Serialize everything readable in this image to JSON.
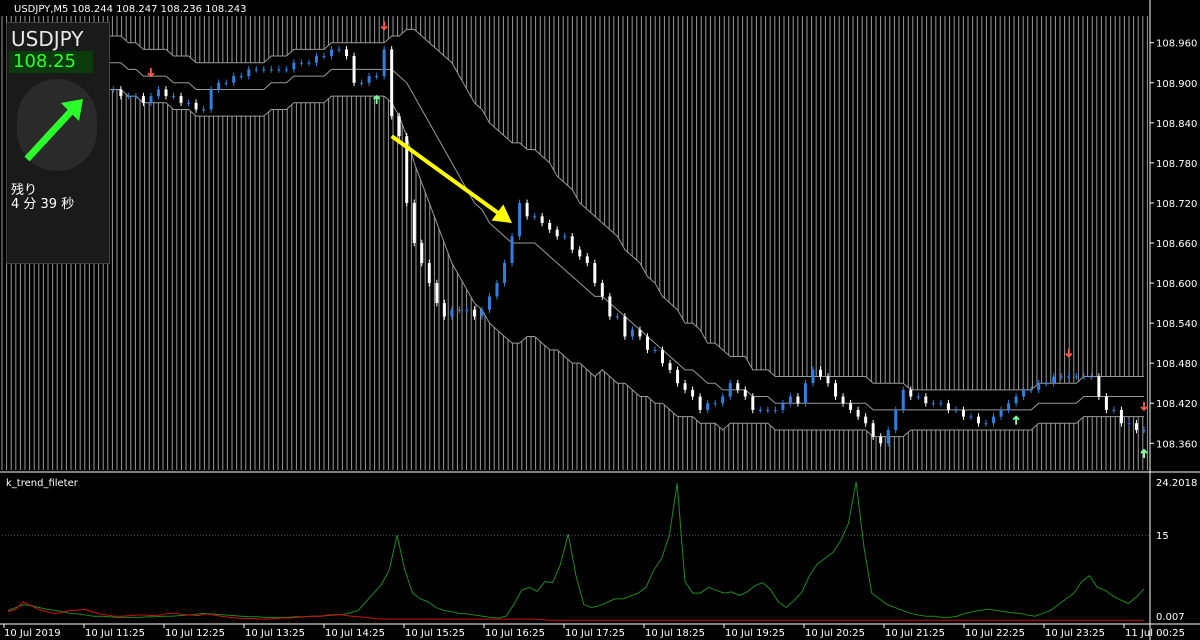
{
  "header": {
    "symbol_line": "USDJPY,M5  108.244 108.247 108.236 108.243"
  },
  "indicator_label": "k_trend_fileter",
  "panel": {
    "symbol": "USDJPY",
    "price": "108.25",
    "remaining_label": "残り",
    "remaining_value": "4 分 39 秒"
  },
  "colors": {
    "background": "#000000",
    "bull_candle": "#2f7fe0",
    "bear_candle": "#ffffff",
    "band_line": "#9a9a9a",
    "down_arrow": "#ff5a4a",
    "up_arrow": "#7dff9a",
    "big_arrow": "#ffff00",
    "green_line": "#1e8a1e",
    "red_line": "#d01010"
  },
  "chart_data": [
    {
      "type": "candlestick",
      "title": "USDJPY,M5",
      "ylim": [
        108.32,
        109.0
      ],
      "yticks": [
        "108.960",
        "108.900",
        "108.840",
        "108.780",
        "108.720",
        "108.660",
        "108.600",
        "108.540",
        "108.480",
        "108.420",
        "108.360"
      ],
      "xticks": [
        "10 Jul 2019",
        "10 Jul 11:25",
        "10 Jul 12:25",
        "10 Jul 13:25",
        "10 Jul 14:25",
        "10 Jul 15:25",
        "10 Jul 16:25",
        "10 Jul 17:25",
        "10 Jul 18:25",
        "10 Jul 19:25",
        "10 Jul 20:25",
        "10 Jul 21:25",
        "10 Jul 22:25",
        "10 Jul 23:25",
        "11 Jul 00:25"
      ],
      "close": [
        108.93,
        108.95,
        108.94,
        108.94,
        108.95,
        108.93,
        108.95,
        108.96,
        108.95,
        108.93,
        108.92,
        108.91,
        108.9,
        108.89,
        108.89,
        108.88,
        108.88,
        108.88,
        108.87,
        108.88,
        108.89,
        108.88,
        108.88,
        108.87,
        108.87,
        108.86,
        108.86,
        108.89,
        108.9,
        108.9,
        108.91,
        108.91,
        108.92,
        108.92,
        108.92,
        108.92,
        108.92,
        108.92,
        108.93,
        108.93,
        108.93,
        108.94,
        108.94,
        108.95,
        108.95,
        108.94,
        108.9,
        108.9,
        108.91,
        108.91,
        108.95,
        108.85,
        108.82,
        108.72,
        108.66,
        108.63,
        108.6,
        108.57,
        108.55,
        108.56,
        108.56,
        108.56,
        108.55,
        108.56,
        108.58,
        108.6,
        108.63,
        108.67,
        108.72,
        108.7,
        108.7,
        108.69,
        108.68,
        108.67,
        108.67,
        108.65,
        108.64,
        108.63,
        108.6,
        108.58,
        108.55,
        108.55,
        108.52,
        108.53,
        108.52,
        108.5,
        108.5,
        108.48,
        108.47,
        108.45,
        108.44,
        108.43,
        108.41,
        108.42,
        108.42,
        108.43,
        108.45,
        108.44,
        108.43,
        108.41,
        108.41,
        108.41,
        108.41,
        108.42,
        108.43,
        108.42,
        108.45,
        108.47,
        108.46,
        108.45,
        108.43,
        108.42,
        108.41,
        108.4,
        108.39,
        108.37,
        108.36,
        108.38,
        108.41,
        108.44,
        108.43,
        108.43,
        108.42,
        108.42,
        108.42,
        108.41,
        108.41,
        108.4,
        108.4,
        108.39,
        108.39,
        108.4,
        108.41,
        108.42,
        108.43,
        108.44,
        108.44,
        108.45,
        108.45,
        108.46,
        108.46,
        108.46,
        108.46,
        108.46,
        108.46,
        108.43,
        108.41,
        108.41,
        108.39,
        108.39,
        108.38,
        108.38
      ],
      "bb_mid": [
        108.93,
        108.93,
        108.93,
        108.93,
        108.93,
        108.93,
        108.93,
        108.93,
        108.93,
        108.93,
        108.93,
        108.93,
        108.93,
        108.93,
        108.93,
        108.93,
        108.92,
        108.92,
        108.91,
        108.91,
        108.91,
        108.91,
        108.9,
        108.9,
        108.9,
        108.89,
        108.89,
        108.89,
        108.89,
        108.89,
        108.89,
        108.89,
        108.89,
        108.89,
        108.89,
        108.9,
        108.9,
        108.9,
        108.91,
        108.91,
        108.91,
        108.91,
        108.91,
        108.92,
        108.92,
        108.92,
        108.92,
        108.92,
        108.92,
        108.92,
        108.92,
        108.92,
        108.91,
        108.9,
        108.88,
        108.86,
        108.84,
        108.82,
        108.8,
        108.78,
        108.76,
        108.74,
        108.72,
        108.71,
        108.69,
        108.68,
        108.67,
        108.66,
        108.66,
        108.66,
        108.66,
        108.65,
        108.64,
        108.63,
        108.62,
        108.61,
        108.6,
        108.59,
        108.58,
        108.58,
        108.57,
        108.56,
        108.55,
        108.54,
        108.53,
        108.52,
        108.51,
        108.5,
        108.49,
        108.48,
        108.47,
        108.47,
        108.46,
        108.45,
        108.45,
        108.44,
        108.44,
        108.44,
        108.44,
        108.43,
        108.43,
        108.43,
        108.42,
        108.42,
        108.42,
        108.42,
        108.42,
        108.42,
        108.42,
        108.42,
        108.42,
        108.42,
        108.42,
        108.42,
        108.42,
        108.41,
        108.41,
        108.41,
        108.41,
        108.41,
        108.41,
        108.41,
        108.41,
        108.41,
        108.41,
        108.41,
        108.41,
        108.41,
        108.41,
        108.41,
        108.41,
        108.41,
        108.41,
        108.41,
        108.41,
        108.41,
        108.41,
        108.42,
        108.42,
        108.42,
        108.42,
        108.42,
        108.42,
        108.43,
        108.43,
        108.43,
        108.43,
        108.43,
        108.43,
        108.43,
        108.43,
        108.43
      ],
      "bb_width": [
        0.04,
        0.04,
        0.04,
        0.04,
        0.04,
        0.04,
        0.04,
        0.04,
        0.04,
        0.04,
        0.04,
        0.04,
        0.04,
        0.04,
        0.04,
        0.04,
        0.04,
        0.04,
        0.04,
        0.04,
        0.04,
        0.04,
        0.04,
        0.04,
        0.04,
        0.04,
        0.04,
        0.04,
        0.04,
        0.04,
        0.04,
        0.04,
        0.04,
        0.04,
        0.04,
        0.04,
        0.04,
        0.04,
        0.04,
        0.04,
        0.04,
        0.04,
        0.04,
        0.04,
        0.04,
        0.04,
        0.04,
        0.04,
        0.04,
        0.04,
        0.04,
        0.05,
        0.06,
        0.08,
        0.1,
        0.11,
        0.12,
        0.13,
        0.14,
        0.15,
        0.15,
        0.15,
        0.15,
        0.15,
        0.15,
        0.15,
        0.15,
        0.15,
        0.15,
        0.14,
        0.14,
        0.14,
        0.14,
        0.13,
        0.13,
        0.13,
        0.12,
        0.12,
        0.12,
        0.11,
        0.11,
        0.11,
        0.1,
        0.1,
        0.1,
        0.09,
        0.09,
        0.08,
        0.08,
        0.08,
        0.07,
        0.07,
        0.07,
        0.06,
        0.06,
        0.06,
        0.05,
        0.05,
        0.05,
        0.04,
        0.04,
        0.04,
        0.04,
        0.04,
        0.04,
        0.04,
        0.04,
        0.04,
        0.04,
        0.04,
        0.04,
        0.04,
        0.04,
        0.04,
        0.04,
        0.04,
        0.04,
        0.04,
        0.04,
        0.04,
        0.03,
        0.03,
        0.03,
        0.03,
        0.03,
        0.03,
        0.03,
        0.03,
        0.03,
        0.03,
        0.03,
        0.03,
        0.03,
        0.03,
        0.03,
        0.03,
        0.03,
        0.03,
        0.03,
        0.03,
        0.03,
        0.03,
        0.03,
        0.03,
        0.03,
        0.03,
        0.03,
        0.03,
        0.03,
        0.03,
        0.03,
        0.03,
        0.03,
        0.03
      ],
      "down_signals": [
        19,
        50,
        141,
        186
      ],
      "up_signals": [
        49,
        134,
        173,
        185
      ]
    },
    {
      "type": "line",
      "title": "k_trend_fileter",
      "yticks": [
        "24.2018",
        "15",
        "0.007"
      ],
      "ylim": [
        0,
        24.2018
      ],
      "series": [
        {
          "color": "#1e8a1e",
          "values": [
            2,
            2.5,
            3,
            2.8,
            2.5,
            2.2,
            2,
            1.8,
            1.5,
            1.4,
            1.2,
            1,
            1,
            0.9,
            0.8,
            0.8,
            0.8,
            0.8,
            0.9,
            0.9,
            1,
            1,
            1.1,
            1.2,
            1.3,
            1.5,
            1.4,
            1.3,
            1.2,
            1.1,
            1,
            0.9,
            0.9,
            0.8,
            0.8,
            0.8,
            0.8,
            0.9,
            0.9,
            1,
            1,
            1.1,
            1.2,
            1.3,
            1.6,
            2,
            3.5,
            5,
            6.5,
            9,
            15,
            9,
            5,
            4,
            3.5,
            2.5,
            2,
            1.8,
            1.5,
            1.4,
            1.2,
            1,
            0.8,
            0.7,
            1,
            3,
            5.5,
            6,
            5.3,
            7,
            6.8,
            10,
            15.2,
            8,
            3,
            2.5,
            2.8,
            3.4,
            4,
            4,
            4.5,
            5,
            6,
            9,
            11,
            15,
            24,
            7,
            5,
            5,
            6,
            5.5,
            5,
            5.2,
            4.6,
            5.2,
            6.3,
            6.8,
            5.6,
            3.5,
            2.5,
            3.7,
            5.1,
            8,
            10,
            11,
            12,
            14,
            17,
            24.2,
            13,
            5,
            4,
            3,
            2.5,
            2,
            1.5,
            1.2,
            1,
            1,
            0.8,
            0.8,
            1,
            1.5,
            1.8,
            2,
            2.2,
            2,
            1.8,
            1.6,
            1.5,
            1.2,
            1,
            1.5,
            2,
            3,
            4,
            5,
            7,
            8,
            6,
            5.5,
            4.5,
            3.8,
            3.2,
            4.3,
            5.7
          ]
        },
        {
          "color": "#d01010",
          "values": [
            1.8,
            2.2,
            3.5,
            2.8,
            2.2,
            1.8,
            1.5,
            1.6,
            2,
            2,
            2.2,
            1.8,
            1.4,
            1.2,
            1,
            1,
            1.1,
            1.2,
            1.2,
            1.1,
            1.2,
            1.5,
            1.5,
            1.3,
            1.2,
            1.1,
            1.4,
            1.2,
            1,
            0.8,
            0.7,
            0.6,
            0.6,
            0.5,
            0.5,
            0.6,
            0.7,
            0.7,
            0.8,
            0.9,
            1,
            1,
            1.2,
            1.3,
            1.2,
            1,
            0.9,
            0.8,
            0.6,
            0.5,
            0.5,
            0.5,
            0.5,
            0.5,
            0.5,
            0.5,
            0.5,
            0.5,
            0.5,
            0.5,
            0.5,
            0.5,
            0.5,
            0.5,
            0.5,
            0.5,
            0.5,
            0.5,
            0.5,
            0.5,
            0.4,
            0.3,
            0.3,
            0.3,
            0.3,
            0.3,
            0.3,
            0.3,
            0.3,
            0.3,
            0.3,
            0.3,
            0.3,
            0.3,
            0.3,
            0.3,
            0.3,
            0.3,
            0.3,
            0.3,
            0.3,
            0.3,
            0.3,
            0.3,
            0.3,
            0.3,
            0.3,
            0.3,
            0.3,
            0.3,
            0.3,
            0.3,
            0.3,
            0.3,
            0.3,
            0.3,
            0.3,
            0.3,
            0.3,
            0.3,
            0.3,
            0.3,
            0.3,
            0.3,
            0.3,
            0.3,
            0.3,
            0.3,
            0.3,
            0.3,
            0.3,
            0.3,
            0.3,
            0.3,
            0.3,
            0.3,
            0.3,
            0.3,
            0.3,
            0.3,
            0.3,
            0.3,
            0.3,
            0.3,
            0.3,
            0.3,
            0.3,
            0.3,
            0.3,
            0.3,
            0.3,
            0.3,
            0.3,
            0.3,
            0.3,
            0.3,
            0.3,
            0.3,
            0.3,
            0.3
          ]
        }
      ]
    }
  ]
}
